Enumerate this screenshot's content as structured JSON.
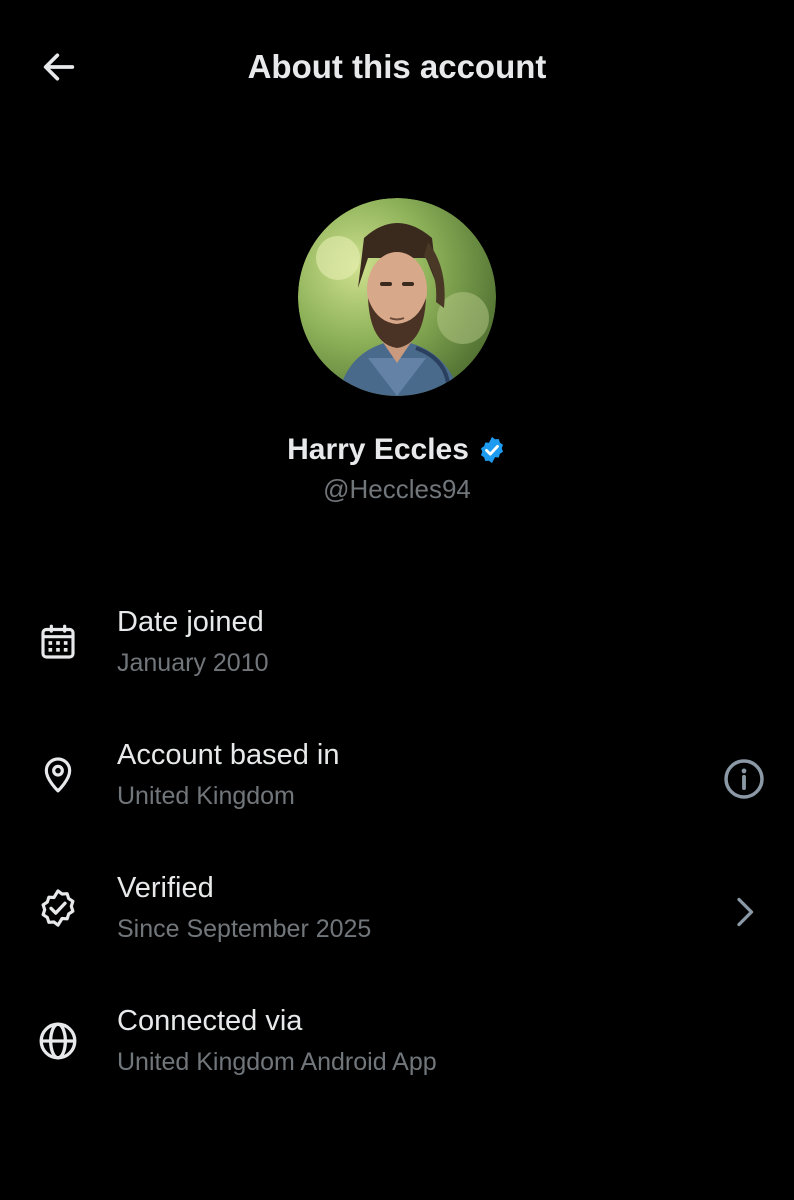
{
  "header": {
    "title": "About this account",
    "back_icon": "arrow-left-icon"
  },
  "profile": {
    "display_name": "Harry Eccles",
    "handle": "@Heccles94",
    "verified": true,
    "badge_color": "#1d9bf0"
  },
  "details": [
    {
      "icon": "calendar-icon",
      "title": "Date joined",
      "value": "January 2010"
    },
    {
      "icon": "location-pin-icon",
      "title": "Account based in",
      "value": "United Kingdom",
      "action_icon": "info-icon"
    },
    {
      "icon": "verified-seal-icon",
      "title": "Verified",
      "value": "Since September 2025",
      "action_icon": "chevron-right-icon"
    },
    {
      "icon": "globe-icon",
      "title": "Connected via",
      "value": "United Kingdom Android App"
    }
  ],
  "colors": {
    "background": "#000000",
    "primary_text": "#e7e9ea",
    "secondary_text": "#71767b",
    "accent": "#1d9bf0"
  }
}
